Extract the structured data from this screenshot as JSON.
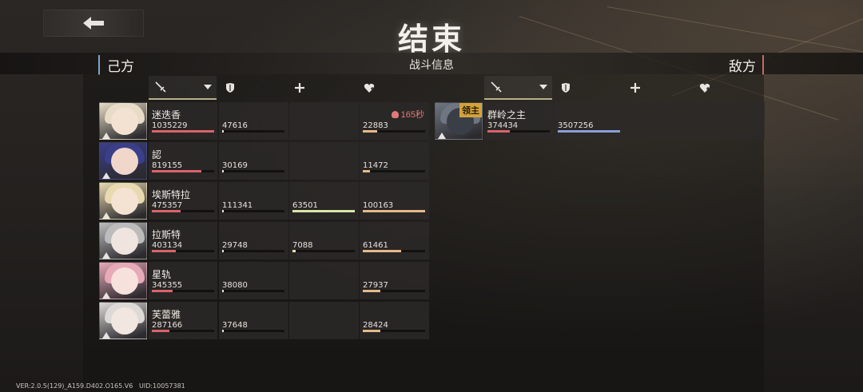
{
  "screen": {
    "title": "结束",
    "section_title": "战斗信息",
    "ally_label": "己方",
    "enemy_label": "敌方",
    "footer_version": "VER:2.0.5(129)_A159.D402.O165.V6",
    "footer_uid": "UID:10057381"
  },
  "back_button": {
    "icon": "back-arrow-icon"
  },
  "column_icons": [
    "sword-icon",
    "shield-icon",
    "plus-icon",
    "heart-plus-icon"
  ],
  "colors": {
    "damage_bar": "#d9646a",
    "taken_bar_ally": "#2a2a2a",
    "heal_bar": "#d8e6a8",
    "shield_bar": "#e6b98a",
    "enemy_taken_bar": "#8a9fd8",
    "timer": "#e07a7a",
    "boss_badge": "#d4a23a"
  },
  "allies": [
    {
      "name": "迷迭香",
      "damage": "1035229",
      "damage_pct": 1.0,
      "taken": "47616",
      "taken_pct": 0.02,
      "heal": "",
      "heal_pct": 0,
      "shield": "22883",
      "shield_pct": 0.23,
      "timer": "165秒",
      "hair": "#e8dcc6",
      "skin": "#f3e2d2"
    },
    {
      "name": "認",
      "damage": "819155",
      "damage_pct": 0.79,
      "taken": "30169",
      "taken_pct": 0.0,
      "heal": "",
      "heal_pct": 0,
      "shield": "11472",
      "shield_pct": 0.11,
      "timer": "",
      "hair": "#3b3f8a",
      "skin": "#f1d7c9"
    },
    {
      "name": "埃斯特拉",
      "damage": "475357",
      "damage_pct": 0.46,
      "taken": "111341",
      "taken_pct": 0.03,
      "heal": "63501",
      "heal_pct": 1.0,
      "shield": "100163",
      "shield_pct": 1.0,
      "timer": "",
      "hair": "#e9d9b0",
      "skin": "#f4e3d3"
    },
    {
      "name": "拉斯特",
      "damage": "403134",
      "damage_pct": 0.39,
      "taken": "29748",
      "taken_pct": 0.0,
      "heal": "7088",
      "heal_pct": 0.05,
      "shield": "61461",
      "shield_pct": 0.61,
      "timer": "",
      "hair": "#bdbcbc",
      "skin": "#efe4de"
    },
    {
      "name": "星轨",
      "damage": "345355",
      "damage_pct": 0.33,
      "taken": "38080",
      "taken_pct": 0.0,
      "heal": "",
      "heal_pct": 0,
      "shield": "27937",
      "shield_pct": 0.28,
      "timer": "",
      "hair": "#e8a9b8",
      "skin": "#f6e1dc"
    },
    {
      "name": "芙蕾雅",
      "damage": "287166",
      "damage_pct": 0.28,
      "taken": "37648",
      "taken_pct": 0.0,
      "heal": "",
      "heal_pct": 0,
      "shield": "28424",
      "shield_pct": 0.28,
      "timer": "",
      "hair": "#dcd9d6",
      "skin": "#f2e6e0"
    }
  ],
  "enemies": [
    {
      "name": "群岭之主",
      "damage": "374434",
      "damage_pct": 0.36,
      "taken": "3507256",
      "taken_pct": 1.0,
      "heal": "",
      "heal_pct": 0,
      "shield": "",
      "shield_pct": 0,
      "badge": "领主",
      "hair": "#6f7682",
      "skin": "#3a3e46"
    }
  ]
}
